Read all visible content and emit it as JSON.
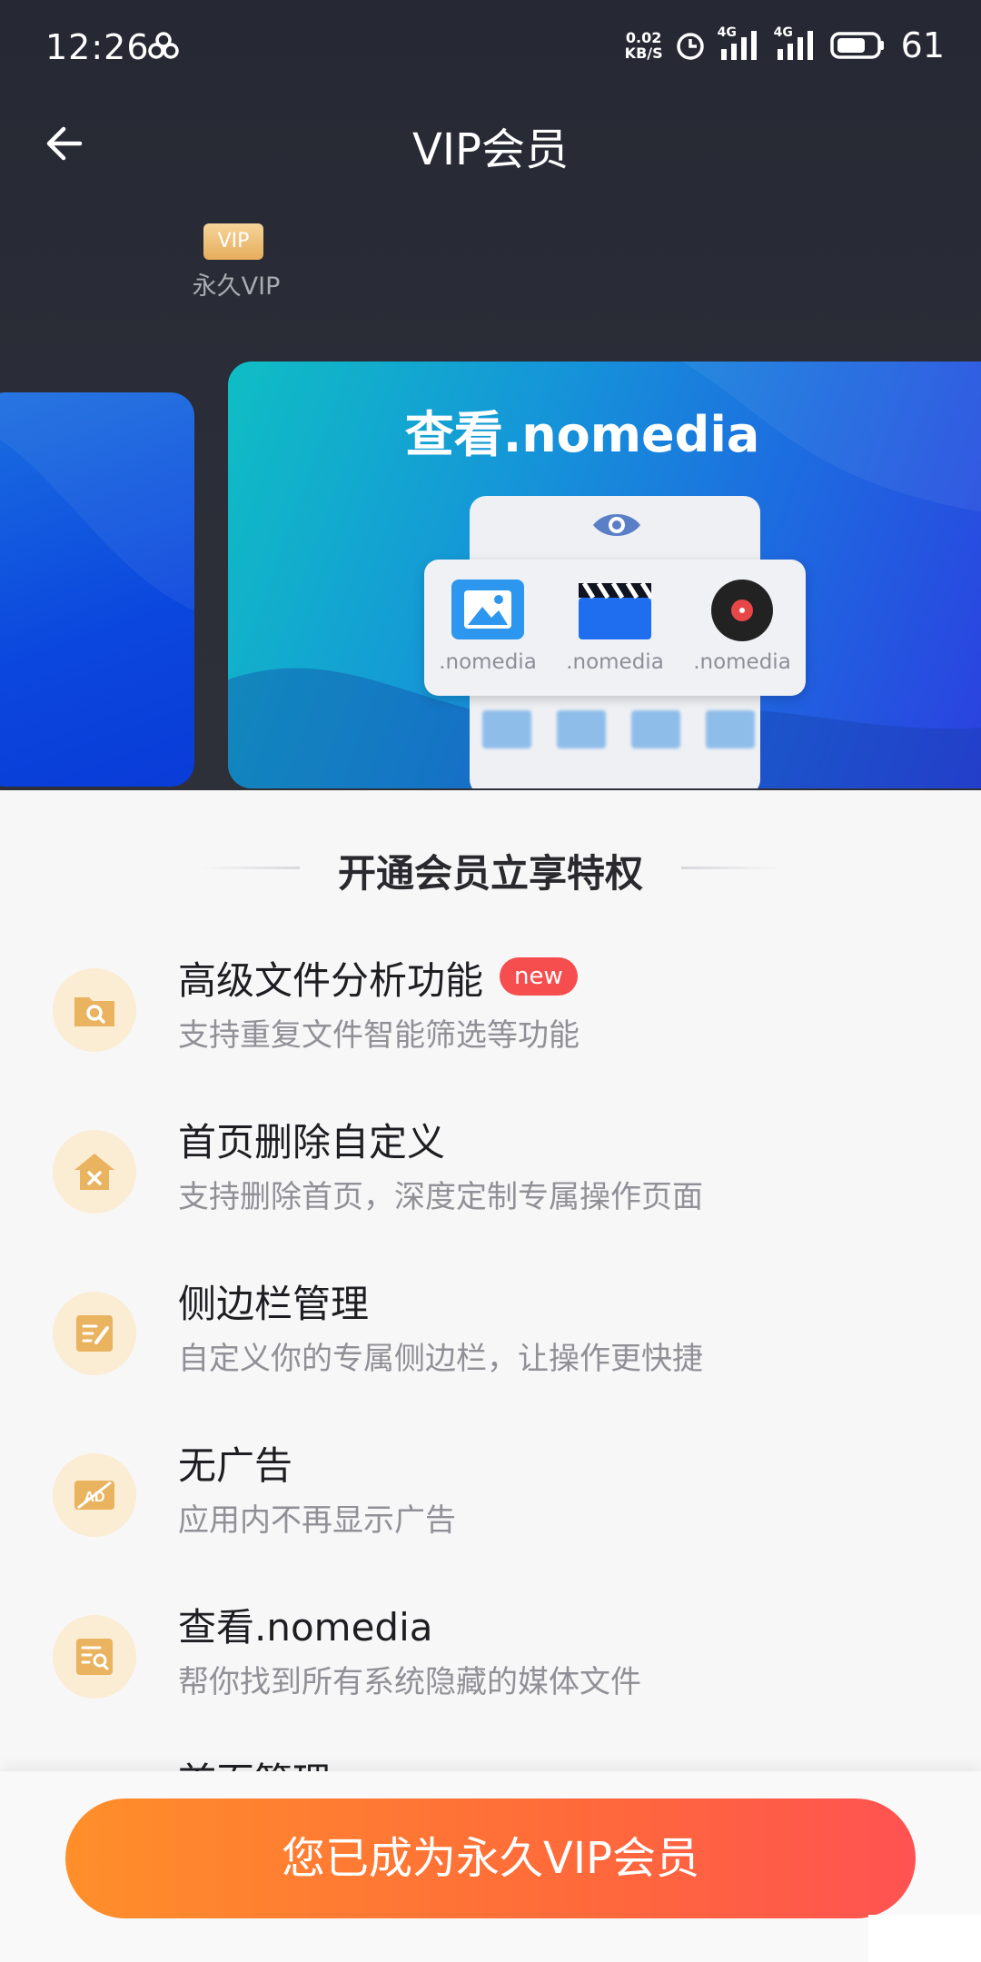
{
  "status_bar": {
    "time": "12:26",
    "net_speed_value": "0.02",
    "net_speed_unit": "KB/S",
    "network_1": "4G",
    "network_2": "4G",
    "battery": "61"
  },
  "nav": {
    "title": "VIP会员"
  },
  "vip_tag": {
    "badge": "VIP",
    "label": "永久VIP"
  },
  "banner": {
    "title": "查看.nomedia",
    "media_items": [
      {
        "label": ".nomedia",
        "icon": "image-icon"
      },
      {
        "label": ".nomedia",
        "icon": "video-clapper-icon"
      },
      {
        "label": ".nomedia",
        "icon": "music-disc-icon"
      }
    ]
  },
  "section": {
    "title": "开通会员立享特权"
  },
  "features": [
    {
      "title": "高级文件分析功能",
      "desc": "支持重复文件智能筛选等功能",
      "badge": "new",
      "icon": "folder-search-icon"
    },
    {
      "title": "首页删除自定义",
      "desc": "支持删除首页，深度定制专属操作页面",
      "icon": "home-delete-icon"
    },
    {
      "title": "侧边栏管理",
      "desc": "自定义你的专属侧边栏，让操作更快捷",
      "icon": "edit-note-icon"
    },
    {
      "title": "无广告",
      "desc": "应用内不再显示广告",
      "icon": "no-ad-icon"
    },
    {
      "title": "查看.nomedia",
      "desc": "帮你找到所有系统隐藏的媒体文件",
      "icon": "file-search-icon"
    },
    {
      "title": "首页管理"
    }
  ],
  "cta": {
    "label": "您已成为永久VIP会员"
  },
  "colors": {
    "header_bg": "#2b2d38",
    "accent_gold": "#e6ad5b",
    "cta_start": "#ff8f2a",
    "cta_end": "#ff5252",
    "new_badge": "#f64e4e"
  }
}
